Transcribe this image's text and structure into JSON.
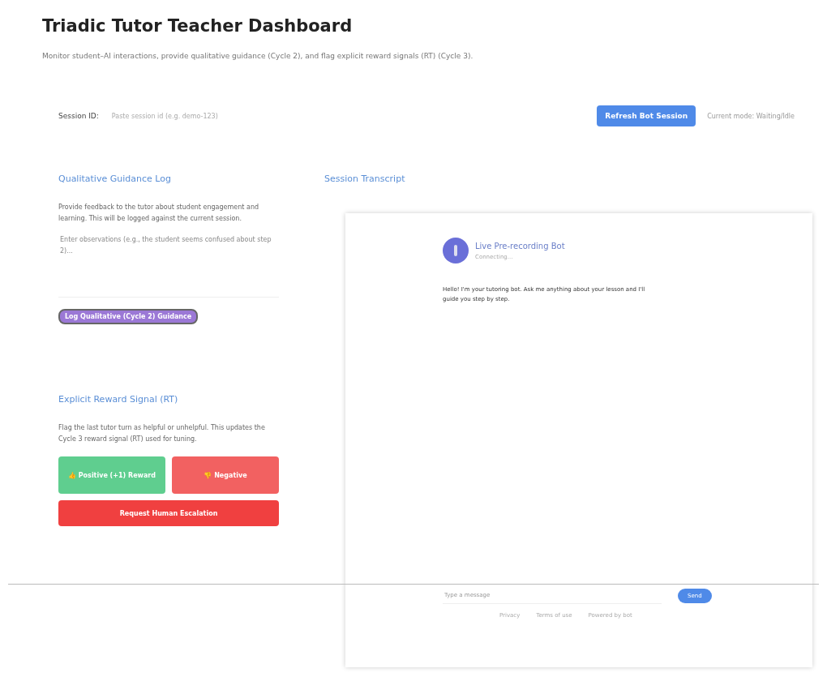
{
  "title": "Triadic Tutor Teacher Dashboard",
  "subtitle": "Monitor student–AI interactions, provide qualitative guidance (Cycle 2), and flag explicit reward signals (RT) (Cycle 3).",
  "session": {
    "label": "Session ID:",
    "placeholder": "Paste session id (e.g. demo-123)",
    "button": "Refresh Bot Session",
    "status": "Current mode: Waiting/Idle"
  },
  "guidance": {
    "heading": "Qualitative Guidance Log",
    "description": "Provide feedback to the tutor about student engagement and learning. This will be logged against the current session.",
    "placeholder": "Enter observations (e.g., the student seems confused about step 2)...",
    "button": "Log Qualitative (Cycle 2) Guidance"
  },
  "reward": {
    "heading": "Explicit Reward Signal (RT)",
    "description": "Flag the last tutor turn as helpful or unhelpful. This updates the Cycle 3 reward signal (RT) used for tuning.",
    "buttons": [
      {
        "kind": "positive",
        "label": "👍 Positive (+1) Reward"
      },
      {
        "kind": "negative",
        "label": "👎 Negative"
      },
      {
        "kind": "escalate",
        "label": "Request Human Escalation"
      }
    ]
  },
  "transcript": {
    "heading": "Session Transcript",
    "bot_name": "Live Pre-recording Bot",
    "bot_status": "Connecting...",
    "message": "Hello! I'm your tutoring bot. Ask me anything about your lesson and I'll guide you step by step.",
    "input_placeholder": "Type a message",
    "send": "Send",
    "footer_links": [
      "Privacy",
      "Terms of use",
      "Powered by bot"
    ]
  }
}
